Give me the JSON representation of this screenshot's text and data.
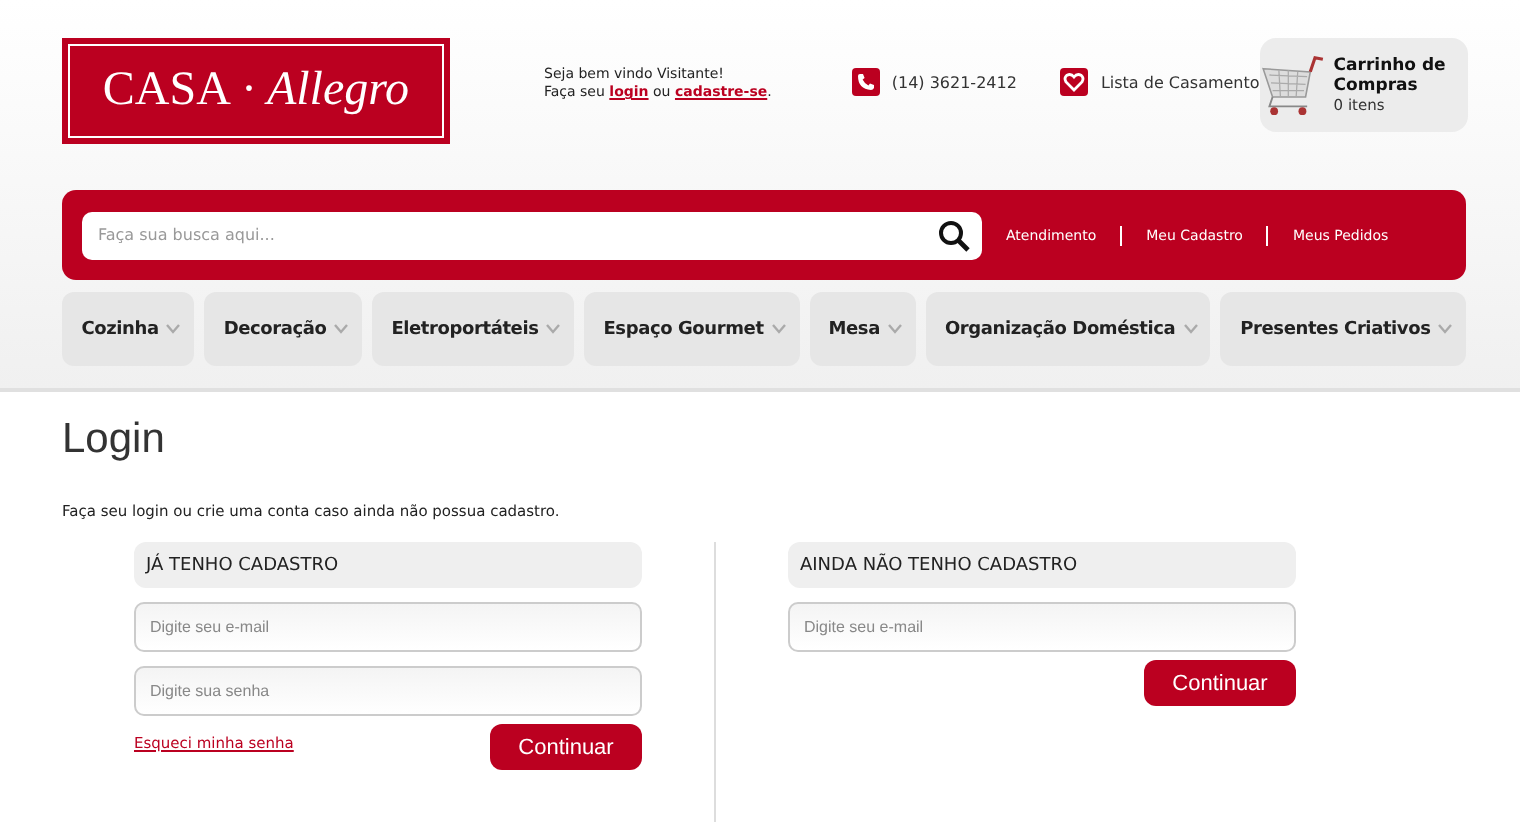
{
  "logo": {
    "brand": "CASA",
    "separator": "·",
    "name": "Allegro"
  },
  "welcome": {
    "line1": "Seja bem vindo Visitante!",
    "prefix": "Faça seu",
    "login_link": "login",
    "middle": "ou",
    "register_link": "cadastre-se",
    "suffix": "."
  },
  "phone": "(14) 3621-2412",
  "wedding_list": "Lista de Casamento",
  "cart": {
    "title": "Carrinho de Compras",
    "count": "0 itens"
  },
  "search": {
    "placeholder": "Faça sua busca aqui..."
  },
  "top_links": [
    "Atendimento",
    "Meu Cadastro",
    "Meus Pedidos"
  ],
  "categories": [
    "Cozinha",
    "Decoração",
    "Eletroportáteis",
    "Espaço Gourmet",
    "Mesa",
    "Organização Doméstica",
    "Presentes Criativos"
  ],
  "page": {
    "title": "Login",
    "intro": "Faça seu login ou crie uma conta caso ainda não possua cadastro."
  },
  "panels": [
    {
      "heading": "JÁ TENHO CADASTRO",
      "fields": [
        {
          "placeholder": "Digite seu e-mail"
        },
        {
          "placeholder": "Digite sua senha"
        }
      ],
      "forgot_link": "Esqueci minha senha",
      "button": "Continuar"
    },
    {
      "heading": "AINDA NÃO TENHO CADASTRO",
      "fields": [
        {
          "placeholder": "Digite seu e-mail"
        }
      ],
      "button": "Continuar"
    }
  ]
}
